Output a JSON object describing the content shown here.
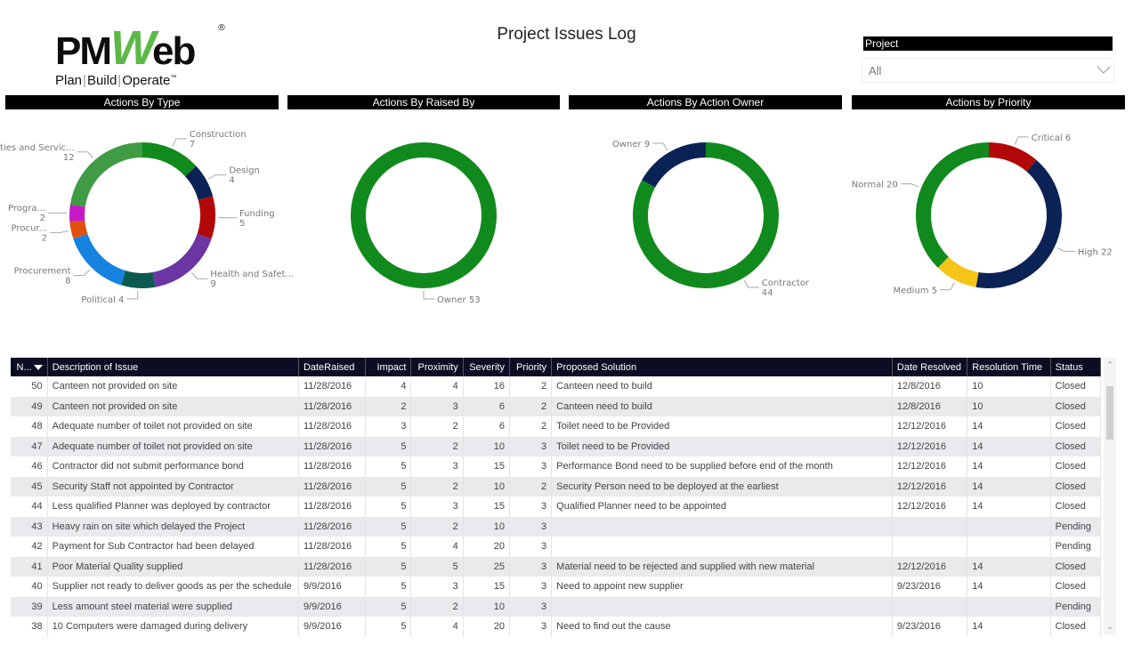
{
  "logo": {
    "prefix": "PM",
    "w": "W",
    "suffix": "eb",
    "reg": "®",
    "tag1": "Plan",
    "tag2": "Build",
    "tag3": "Operate",
    "tm": "™"
  },
  "header": {
    "title": "Project Issues Log"
  },
  "slicer": {
    "label": "Project",
    "value": "All"
  },
  "chart_data": [
    {
      "type": "pie",
      "title": "Actions By Type",
      "donut": true,
      "slices": [
        {
          "label": "Construction",
          "value": 7,
          "color": "#118a1d"
        },
        {
          "label": "Design",
          "value": 4,
          "color": "#0b2255"
        },
        {
          "label": "Funding",
          "value": 5,
          "color": "#b30808"
        },
        {
          "label": "Health and Safet...",
          "value": 9,
          "color": "#6b35a3"
        },
        {
          "label": "Political",
          "value": 4,
          "color": "#0b5a51"
        },
        {
          "label": "Procurement",
          "value": 8,
          "color": "#1482de"
        },
        {
          "label": "Procur...",
          "value": 2,
          "color": "#e14f0e"
        },
        {
          "label": "Progra...",
          "value": 2,
          "color": "#c51ac5"
        },
        {
          "label": "Utilities and Servic...",
          "value": 12,
          "color": "#3f9c44"
        }
      ]
    },
    {
      "type": "pie",
      "title": "Actions By Raised By",
      "donut": true,
      "slices": [
        {
          "label": "Owner",
          "value": 53,
          "color": "#118a1d"
        }
      ]
    },
    {
      "type": "pie",
      "title": "Actions By Action Owner",
      "donut": true,
      "slices": [
        {
          "label": "Contractor",
          "value": 44,
          "color": "#118a1d"
        },
        {
          "label": "Owner",
          "value": 9,
          "color": "#0b2255"
        }
      ]
    },
    {
      "type": "pie",
      "title": "Actions by Priority",
      "donut": true,
      "slices": [
        {
          "label": "Critical",
          "value": 6,
          "color": "#b30808"
        },
        {
          "label": "High",
          "value": 22,
          "color": "#0b2255"
        },
        {
          "label": "Medium",
          "value": 5,
          "color": "#f5c518"
        },
        {
          "label": "Normal",
          "value": 20,
          "color": "#118a1d"
        }
      ]
    }
  ],
  "table": {
    "columns": [
      "N...",
      "Description of Issue",
      "DateRaised",
      "Impact",
      "Proximity",
      "Severity",
      "Priority",
      "Proposed Solution",
      "Date Resolved",
      "Resolution Time",
      "Status"
    ],
    "rows": [
      [
        "50",
        "Canteen not provided on site",
        "11/28/2016",
        "4",
        "4",
        "16",
        "2",
        "Canteen need to build",
        "12/8/2016",
        "10",
        "Closed"
      ],
      [
        "49",
        "Canteen not provided on site",
        "11/28/2016",
        "2",
        "3",
        "6",
        "2",
        "Canteen need to build",
        "12/8/2016",
        "10",
        "Closed"
      ],
      [
        "48",
        "Adequate number of toilet not provided on site",
        "11/28/2016",
        "3",
        "2",
        "6",
        "2",
        "Toilet need to be Provided",
        "12/12/2016",
        "14",
        "Closed"
      ],
      [
        "47",
        "Adequate number of toilet not provided on site",
        "11/28/2016",
        "5",
        "2",
        "10",
        "3",
        "Toilet need to be Provided",
        "12/12/2016",
        "14",
        "Closed"
      ],
      [
        "46",
        "Contractor did not submit performance bond",
        "11/28/2016",
        "5",
        "3",
        "15",
        "3",
        "Performance Bond need to be supplied before end of the month",
        "12/12/2016",
        "14",
        "Closed"
      ],
      [
        "45",
        "Security Staff not appointed by Contractor",
        "11/28/2016",
        "5",
        "2",
        "10",
        "2",
        "Security Person need to be deployed at the earliest",
        "12/12/2016",
        "14",
        "Closed"
      ],
      [
        "44",
        "Less qualified Planner was deployed by contractor",
        "11/28/2016",
        "5",
        "3",
        "15",
        "3",
        "Qualified Planner need to be appointed",
        "12/12/2016",
        "14",
        "Closed"
      ],
      [
        "43",
        "Heavy rain on site which delayed the Project",
        "11/28/2016",
        "5",
        "2",
        "10",
        "3",
        "",
        "",
        "",
        "Pending"
      ],
      [
        "42",
        "Payment for Sub Contractor had been delayed",
        "11/28/2016",
        "5",
        "4",
        "20",
        "3",
        "",
        "",
        "",
        "Pending"
      ],
      [
        "41",
        "Poor Material Quality supplied",
        "11/28/2016",
        "5",
        "5",
        "25",
        "3",
        "Material need to be rejected and supplied with new material",
        "12/12/2016",
        "14",
        "Closed"
      ],
      [
        "40",
        "Supplier not ready to deliver goods as per the schedule",
        "9/9/2016",
        "5",
        "3",
        "15",
        "3",
        "Need to appoint new supplier",
        "9/23/2016",
        "14",
        "Closed"
      ],
      [
        "39",
        "Less amount steel material were supplied",
        "9/9/2016",
        "5",
        "2",
        "10",
        "3",
        "",
        "",
        "",
        "Pending"
      ],
      [
        "38",
        "10 Computers were damaged during delivery",
        "9/9/2016",
        "5",
        "4",
        "20",
        "3",
        "Need to find out the cause",
        "9/23/2016",
        "14",
        "Closed"
      ]
    ]
  },
  "scroll": {
    "up": "^",
    "down": "v"
  }
}
